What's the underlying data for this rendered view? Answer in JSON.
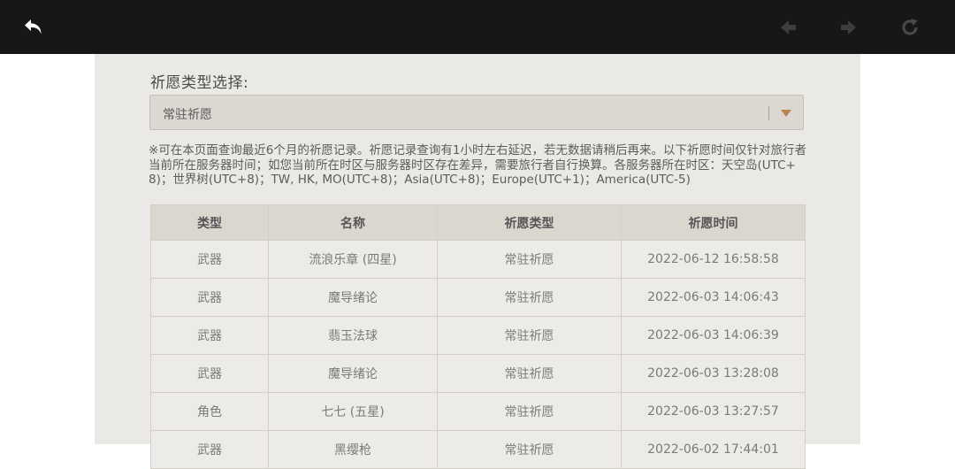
{
  "toolbar": {
    "back_icon": "back-arrow-icon",
    "prev_icon": "prev-arrow-icon",
    "next_icon": "next-arrow-icon",
    "reload_icon": "reload-icon"
  },
  "filter": {
    "label": "祈愿类型选择:",
    "selected": "常驻祈愿"
  },
  "notice": "※可在本页面查询最近6个月的祈愿记录。祈愿记录查询有1小时左右延迟，若无数据请稍后再来。以下祈愿时间仅针对旅行者当前所在服务器时间；如您当前所在时区与服务器时区存在差异，需要旅行者自行换算。各服务器所在时区：天空岛(UTC+8)；世界树(UTC+8)；TW, HK, MO(UTC+8)；Asia(UTC+8)；Europe(UTC+1)；America(UTC-5)",
  "table": {
    "headers": [
      "类型",
      "名称",
      "祈愿类型",
      "祈愿时间"
    ],
    "rows": [
      {
        "type": "武器",
        "name": "流浪乐章 (四星)",
        "pool": "常驻祈愿",
        "time": "2022-06-12 16:58:58",
        "rarity": "four"
      },
      {
        "type": "武器",
        "name": "魔导绪论",
        "pool": "常驻祈愿",
        "time": "2022-06-03 14:06:43",
        "rarity": "three"
      },
      {
        "type": "武器",
        "name": "翡玉法球",
        "pool": "常驻祈愿",
        "time": "2022-06-03 14:06:39",
        "rarity": "three"
      },
      {
        "type": "武器",
        "name": "魔导绪论",
        "pool": "常驻祈愿",
        "time": "2022-06-03 13:28:08",
        "rarity": "three"
      },
      {
        "type": "角色",
        "name": "七七 (五星)",
        "pool": "常驻祈愿",
        "time": "2022-06-03 13:27:57",
        "rarity": "five"
      },
      {
        "type": "武器",
        "name": "黑缨枪",
        "pool": "常驻祈愿",
        "time": "2022-06-02 17:44:01",
        "rarity": "three"
      }
    ]
  },
  "colors": {
    "topbar": "#171717",
    "panel": "#ebe9e5",
    "four_star": "#a256e1",
    "five_star": "#bd6932",
    "caret": "#b5864f"
  }
}
